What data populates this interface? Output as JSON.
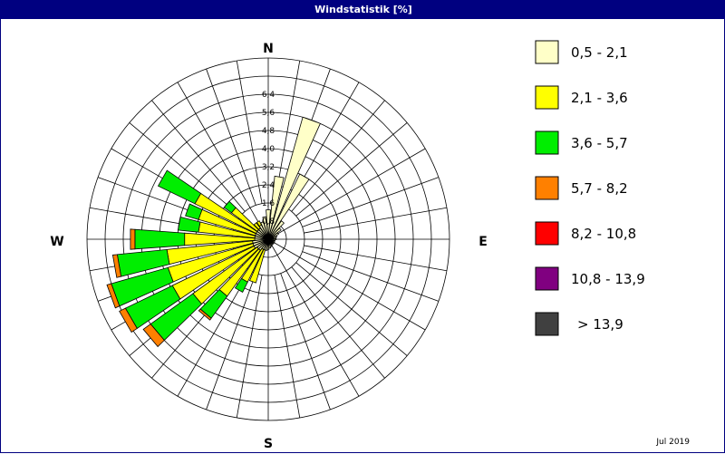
{
  "window": {
    "title": "Windstatistik [%]",
    "date": "Jul 2019"
  },
  "chart_data": {
    "type": "wind-rose",
    "title": "Windstatistik [%]",
    "unit": "%",
    "compass": [
      "N",
      "E",
      "S",
      "W"
    ],
    "ring_labels": [
      "0,8",
      "1,6",
      "2,4",
      "3,2",
      "4,0",
      "4,8",
      "5,6",
      "6,4"
    ],
    "rmax": 8.0,
    "sector_count": 36,
    "speed_classes": [
      {
        "label": "0,5 - 2,1",
        "color": "#ffffc8"
      },
      {
        "label": "2,1 - 3,6",
        "color": "#ffff00"
      },
      {
        "label": "3,6 - 5,7",
        "color": "#00ee00"
      },
      {
        "label": "5,7 - 8,2",
        "color": "#ff8000"
      },
      {
        "label": "8,2 - 10,8",
        "color": "#ff0000"
      },
      {
        "label": "10,8 - 13,9",
        "color": "#800080"
      },
      {
        "label": "> 13,9",
        "color": "#404040"
      }
    ],
    "sectors": [
      {
        "dir": 0,
        "values": [
          1.3
        ]
      },
      {
        "dir": 10,
        "values": [
          2.8
        ]
      },
      {
        "dir": 20,
        "values": [
          5.6
        ]
      },
      {
        "dir": 30,
        "values": [
          3.2
        ]
      },
      {
        "dir": 40,
        "values": [
          1.0
        ]
      },
      {
        "dir": 50,
        "values": [
          0.7
        ]
      },
      {
        "dir": 60,
        "values": [
          0.5
        ]
      },
      {
        "dir": 70,
        "values": [
          0.4
        ]
      },
      {
        "dir": 80,
        "values": [
          0.35
        ]
      },
      {
        "dir": 90,
        "values": [
          0.35
        ]
      },
      {
        "dir": 100,
        "values": [
          0.3
        ]
      },
      {
        "dir": 110,
        "values": [
          0.3
        ]
      },
      {
        "dir": 120,
        "values": [
          0.3
        ]
      },
      {
        "dir": 130,
        "values": [
          0.3
        ]
      },
      {
        "dir": 140,
        "values": [
          0.3
        ]
      },
      {
        "dir": 150,
        "values": [
          0.3
        ]
      },
      {
        "dir": 160,
        "values": [
          0.35
        ]
      },
      {
        "dir": 170,
        "values": [
          0.4
        ]
      },
      {
        "dir": 180,
        "values": [
          0.45
        ]
      },
      {
        "dir": 190,
        "values": [
          0.5
        ]
      },
      {
        "dir": 200,
        "values": [
          0.5,
          1.5
        ]
      },
      {
        "dir": 210,
        "values": [
          0.5,
          1.6,
          0.5
        ]
      },
      {
        "dir": 220,
        "values": [
          0.6,
          2.5,
          1.2,
          0.1
        ]
      },
      {
        "dir": 230,
        "values": [
          0.6,
          3.5,
          2.3,
          0.4
        ]
      },
      {
        "dir": 240,
        "values": [
          0.7,
          4.0,
          2.3,
          0.3
        ]
      },
      {
        "dir": 250,
        "values": [
          0.7,
          3.9,
          2.6,
          0.2
        ]
      },
      {
        "dir": 260,
        "values": [
          0.7,
          3.8,
          2.2,
          0.2
        ]
      },
      {
        "dir": 270,
        "values": [
          0.6,
          3.1,
          2.2,
          0.2
        ]
      },
      {
        "dir": 280,
        "values": [
          0.6,
          2.5,
          0.9
        ]
      },
      {
        "dir": 290,
        "values": [
          0.6,
          2.6,
          0.6
        ]
      },
      {
        "dir": 300,
        "values": [
          0.6,
          3.0,
          1.8
        ]
      },
      {
        "dir": 310,
        "values": [
          0.6,
          1.4,
          0.4
        ]
      },
      {
        "dir": 320,
        "values": [
          0.6,
          0.3
        ]
      },
      {
        "dir": 330,
        "values": [
          0.7,
          0.2
        ]
      },
      {
        "dir": 340,
        "values": [
          0.8
        ]
      },
      {
        "dir": 350,
        "values": [
          1.0
        ]
      }
    ]
  }
}
